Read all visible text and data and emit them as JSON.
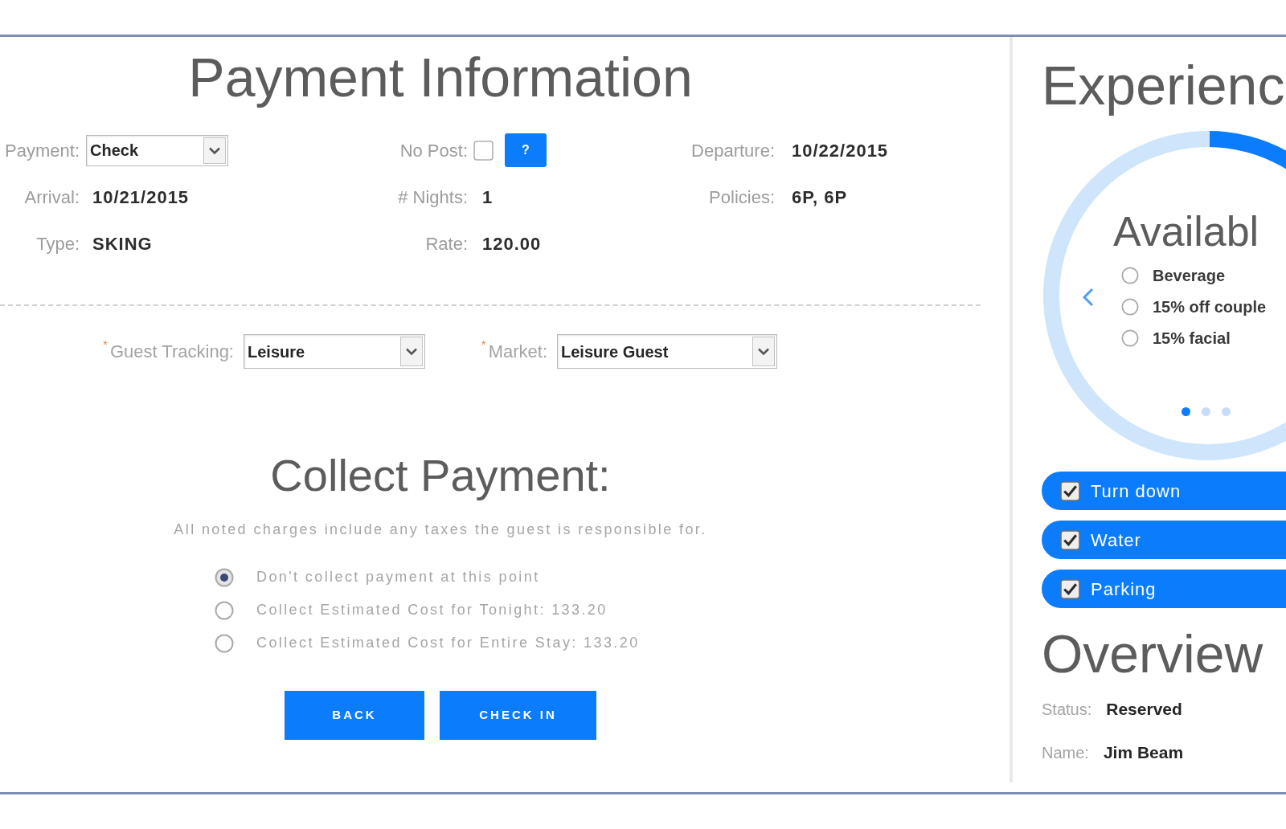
{
  "payment_information": {
    "title": "Payment Information",
    "fields": [
      {
        "kind": "select",
        "label": "Payment:",
        "value": "Check"
      },
      {
        "kind": "checkbox",
        "label": "No Post:",
        "checked": false,
        "button": "?"
      },
      {
        "kind": "text",
        "label": "Departure:",
        "value": "10/22/2015"
      },
      {
        "kind": "text",
        "label": "Arrival:",
        "value": "10/21/2015"
      },
      {
        "kind": "text",
        "label": "# Nights:",
        "value": "1"
      },
      {
        "kind": "text",
        "label": "Policies:",
        "value": "6P, 6P"
      },
      {
        "kind": "text",
        "label": "Type:",
        "value": "SKING"
      },
      {
        "kind": "text",
        "label": "Rate:",
        "value": "120.00"
      }
    ],
    "tracking_fields": [
      {
        "required_mark": "*",
        "label": "Guest Tracking:",
        "value": "Leisure"
      },
      {
        "required_mark": "*",
        "label": "Market:",
        "value": "Leisure Guest"
      }
    ]
  },
  "collect_payment": {
    "title": "Collect Payment:",
    "note": "All noted charges include any taxes the guest is responsible for.",
    "options": [
      {
        "label": "Don't collect payment at this point",
        "selected": true
      },
      {
        "label": "Collect Estimated Cost for Tonight: 133.20",
        "selected": false
      },
      {
        "label": "Collect Estimated Cost for Entire Stay: 133.20",
        "selected": false
      }
    ],
    "buttons": [
      "BACK",
      "CHECK IN"
    ]
  },
  "experience": {
    "title": "Experienc",
    "carousel": {
      "title": "Availabl",
      "options": [
        {
          "label": "Beverage",
          "selected": false
        },
        {
          "label": "15% off couple",
          "selected": false
        },
        {
          "label": "15% facial",
          "selected": false
        }
      ],
      "pages": [
        {
          "selected": true
        },
        {
          "selected": false
        },
        {
          "selected": false
        }
      ]
    },
    "amenities": [
      {
        "label": "Turn down",
        "checked": true
      },
      {
        "label": "Water",
        "checked": true
      },
      {
        "label": "Parking",
        "checked": true
      }
    ]
  },
  "overview": {
    "title": "Overview",
    "fields": [
      {
        "label": "Status:",
        "value": "Reserved"
      },
      {
        "label": "Name:",
        "value": "Jim Beam"
      }
    ]
  }
}
